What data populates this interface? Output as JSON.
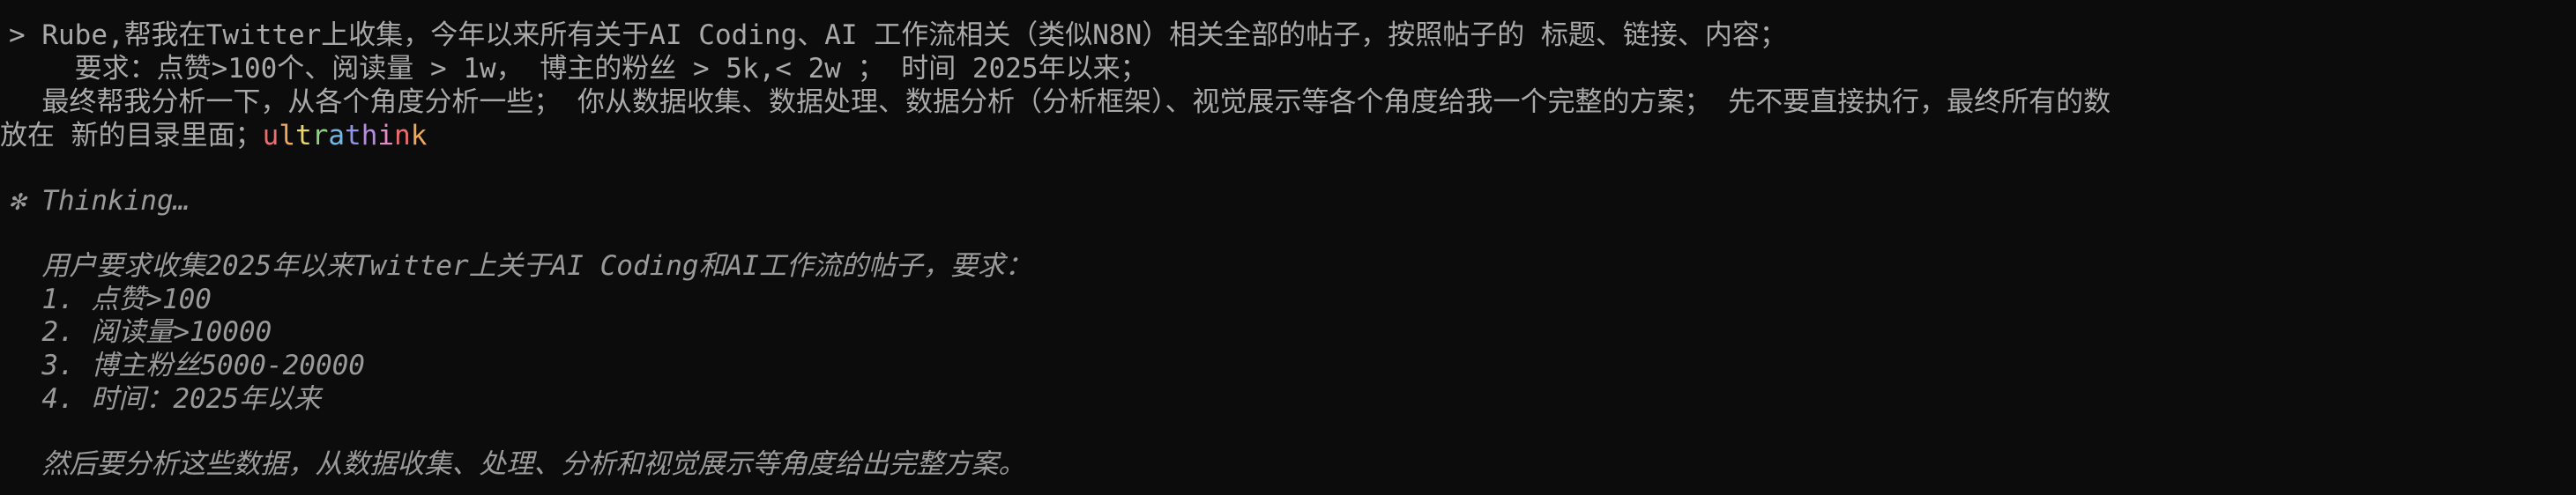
{
  "prompt": {
    "symbol": ">",
    "line1": " Rube,帮我在Twitter上收集，今年以来所有关于AI Coding、AI 工作流相关（类似N8N）相关全部的帖子，按照帖子的 标题、链接、内容；",
    "line2": "    要求：点赞>100个、阅读量 > 1w， 博主的粉丝 > 5k,< 2w ； 时间 2025年以来；",
    "line3": "  最终帮我分析一下，从各个角度分析一些； 你从数据收集、数据处理、数据分析（分析框架）、视觉展示等各个角度给我一个完整的方案； 先不要直接执行，最终所有的数",
    "line4_prefix": "放在 新的目录里面；",
    "keyword": "ultrathink"
  },
  "thinking": {
    "header": "✻ Thinking…",
    "intro": "  用户要求收集2025年以来Twitter上关于AI Coding和AI工作流的帖子，要求：",
    "items": [
      "  1. 点赞>100",
      "  2. 阅读量>10000",
      "  3. 博主粉丝5000-20000",
      "  4. 时间：2025年以来"
    ],
    "conclusion": "  然后要分析这些数据，从数据收集、处理、分析和视觉展示等角度给出完整方案。"
  },
  "colors": {
    "background": "#0c0c0c",
    "text": "#a9a9a9",
    "thinking_text": "#9a9a9a",
    "keyword_gradient": [
      "#ec6d6d",
      "#f0a85a",
      "#e9d76a",
      "#8bd47a",
      "#6fb9e6",
      "#8f94e8",
      "#b88be0",
      "#e48bc6",
      "#ec6d6d",
      "#f0a85a"
    ]
  }
}
